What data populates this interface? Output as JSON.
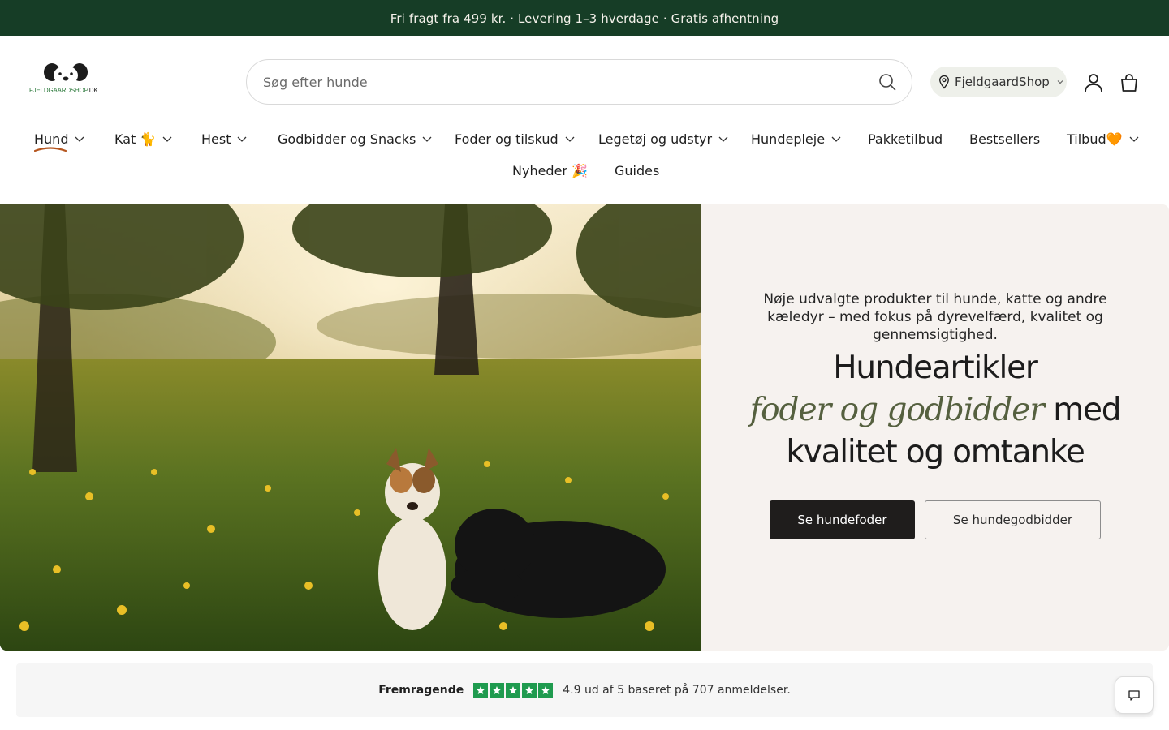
{
  "announcement": "Fri fragt fra 499 kr. · Levering 1–3 hverdage · Gratis afhentning",
  "logo": {
    "text": "FJELDGAARDSHOP",
    "suffix": ".DK"
  },
  "search": {
    "placeholder": "Søg efter hunde",
    "value": ""
  },
  "store_selector": {
    "label": "FjeldgaardShop"
  },
  "nav": {
    "row1": [
      {
        "label": "Hund",
        "has_dropdown": true,
        "active": true
      },
      {
        "label": "Kat 🐈",
        "has_dropdown": true
      },
      {
        "label": "Hest",
        "has_dropdown": true
      },
      {
        "label": "Godbidder og Snacks",
        "has_dropdown": true
      },
      {
        "label": "Foder og tilskud",
        "has_dropdown": true
      },
      {
        "label": "Legetøj og udstyr",
        "has_dropdown": true
      },
      {
        "label": "Hundepleje",
        "has_dropdown": true
      },
      {
        "label": "Pakketilbud",
        "has_dropdown": false
      },
      {
        "label": "Bestsellers",
        "has_dropdown": false
      },
      {
        "label": "Tilbud🧡",
        "has_dropdown": true
      }
    ],
    "row2": [
      {
        "label": "Nyheder 🎉",
        "has_dropdown": false
      },
      {
        "label": "Guides",
        "has_dropdown": false
      }
    ]
  },
  "hero": {
    "subtitle": "Nøje udvalgte produkter til hunde, katte og andre kæledyr – med fokus på dyrevelfærd, kvalitet og gennemsigtighed.",
    "title_line1": "Hundeartikler",
    "title_script": "foder og godbidder",
    "title_after_script": " med",
    "title_line3": "kvalitet og omtanke",
    "primary_button": "Se hundefoder",
    "secondary_button": "Se hundegodbidder"
  },
  "reviews": {
    "label": "Fremragende",
    "stars": 5,
    "summary": "4.9 ud af 5 baseret på 707 anmeldelser."
  },
  "colors": {
    "announcement_bg": "#163d26",
    "accent_underline": "#b5561f",
    "primary_button_bg": "#1f1d1c",
    "hero_panel_bg": "#f6f2ef",
    "script_text": "#55603f",
    "star_green": "#1f9b4f"
  },
  "icons": {
    "search": "search-icon",
    "location": "location-pin-icon",
    "account": "user-icon",
    "cart": "shopping-bag-icon",
    "chat": "chat-bubble-icon"
  }
}
